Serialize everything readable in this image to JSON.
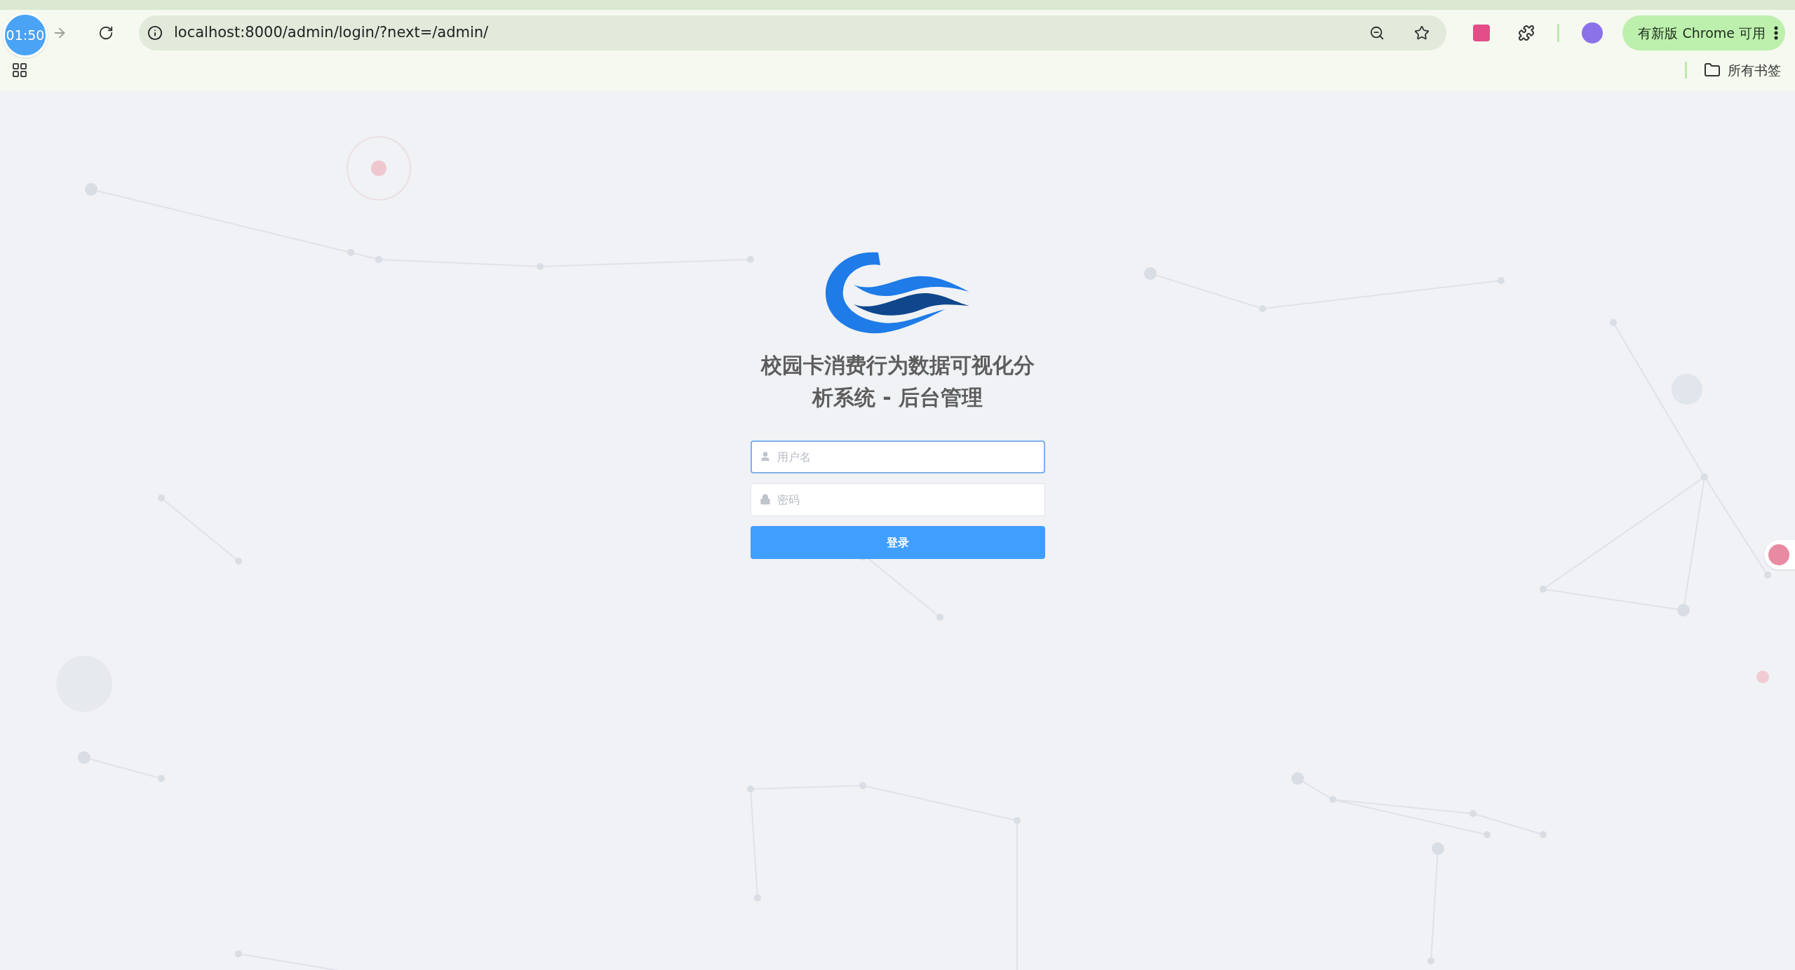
{
  "browser": {
    "timer": "01:50",
    "url": "localhost:8000/admin/login/?next=/admin/",
    "update_button": "有新版 Chrome 可用",
    "bookmarks_label": "所有书签"
  },
  "login": {
    "title": "校园卡消费行为数据可视化分析系统 - 后台管理",
    "fields": [
      {
        "kind": "user",
        "placeholder": "用户名",
        "focused": true
      },
      {
        "kind": "lock",
        "placeholder": "密码",
        "focused": false
      }
    ],
    "submit": "登录"
  }
}
